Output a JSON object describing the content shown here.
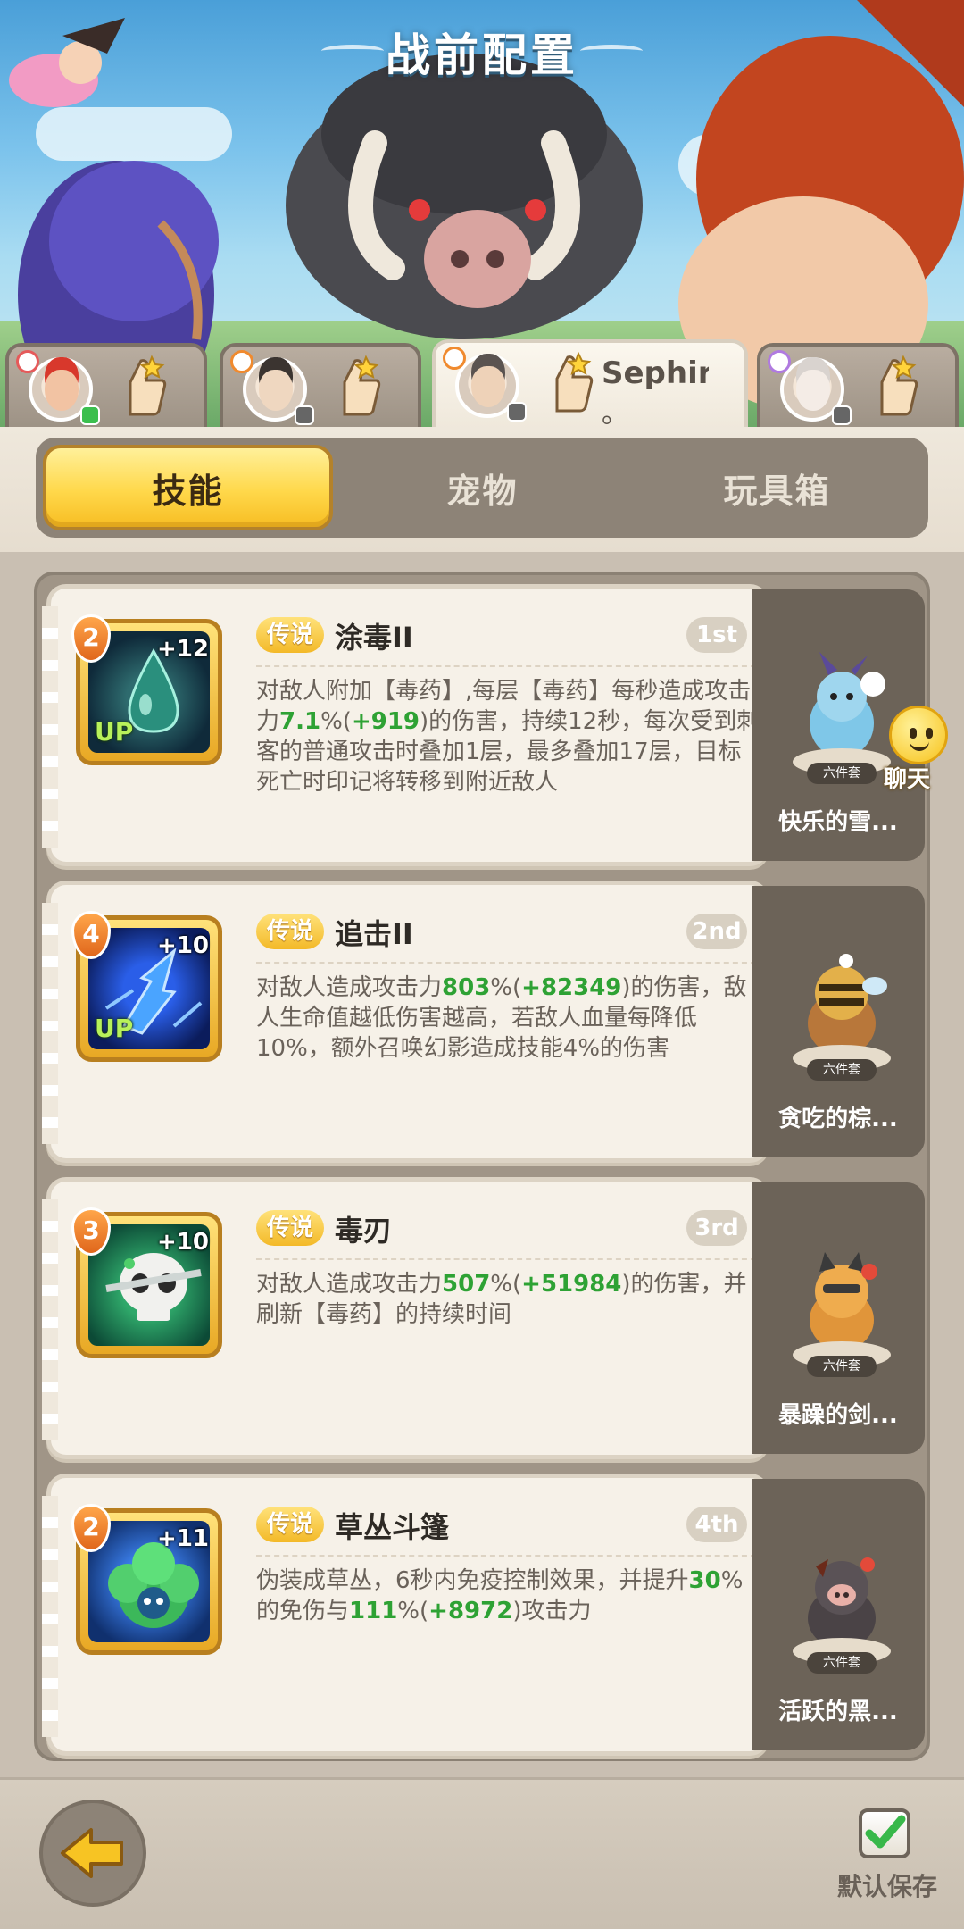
{
  "header": {
    "title": "战前配置"
  },
  "players": [
    {
      "name": "",
      "name_line2": "",
      "rank_color": "#e55a5a",
      "mic": "green"
    },
    {
      "name": "",
      "name_line2": "",
      "rank_color": "#f08a2e",
      "mic": "gray"
    },
    {
      "name": "Sephir..",
      "name_line2": "。",
      "rank_color": "#f08a2e",
      "mic": "gray",
      "active": true
    },
    {
      "name": "",
      "name_line2": "",
      "rank_color": "#b07ae0",
      "mic": "gray"
    }
  ],
  "category_tabs": [
    {
      "label": "技能",
      "active": true
    },
    {
      "label": "宠物",
      "active": false
    },
    {
      "label": "玩具箱",
      "active": false
    }
  ],
  "skills": [
    {
      "level": "2",
      "plus": "+12",
      "up": "UP",
      "rarity": "传说",
      "name": "涂毒II",
      "order": "1st",
      "desc_parts": [
        {
          "t": "对敌人附加【毒药】,每层【毒药】每秒造成攻击力"
        },
        {
          "t": "7.1",
          "g": true
        },
        {
          "t": "%("
        },
        {
          "t": "+919",
          "g": true
        },
        {
          "t": ")的伤害，持续12秒，每次受到刺客的普通攻击时叠加1层，最多叠加17层，目标死亡时印记将转移到附近敌人"
        }
      ],
      "icon": "poison-drop-icon",
      "pet": {
        "name": "快乐的雪...",
        "set": "六件套",
        "icon": "snow-rabbit-pet-icon"
      }
    },
    {
      "level": "4",
      "plus": "+10",
      "up": "UP",
      "rarity": "传说",
      "name": "追击II",
      "order": "2nd",
      "desc_parts": [
        {
          "t": "对敌人造成攻击力"
        },
        {
          "t": "803",
          "g": true
        },
        {
          "t": "%("
        },
        {
          "t": "+82349",
          "g": true
        },
        {
          "t": ")的伤害，敌人生命值越低伤害越高，若敌人血量每降低10%，额外召唤幻影造成技能4%的伤害"
        }
      ],
      "icon": "shadow-strike-icon",
      "pet": {
        "name": "贪吃的棕...",
        "set": "六件套",
        "icon": "brown-bear-bee-pet-icon"
      }
    },
    {
      "level": "3",
      "plus": "+10",
      "up": "",
      "rarity": "传说",
      "name": "毒刃",
      "order": "3rd",
      "desc_parts": [
        {
          "t": "对敌人造成攻击力"
        },
        {
          "t": "507",
          "g": true
        },
        {
          "t": "%("
        },
        {
          "t": "+51984",
          "g": true
        },
        {
          "t": ")的伤害，并刷新【毒药】的持续时间"
        }
      ],
      "icon": "skull-blade-icon",
      "pet": {
        "name": "暴躁的剑...",
        "set": "六件套",
        "icon": "sword-cat-pet-icon"
      }
    },
    {
      "level": "2",
      "plus": "+11",
      "up": "",
      "rarity": "传说",
      "name": "草丛斗篷",
      "order": "4th",
      "desc_parts": [
        {
          "t": "伪装成草丛，6秒内免疫控制效果，并提升"
        },
        {
          "t": "30",
          "g": true
        },
        {
          "t": "%的免伤与"
        },
        {
          "t": "111",
          "g": true
        },
        {
          "t": "%("
        },
        {
          "t": "+8972",
          "g": true
        },
        {
          "t": ")攻击力"
        }
      ],
      "icon": "bush-cloak-icon",
      "pet": {
        "name": "活跃的黑...",
        "set": "六件套",
        "icon": "black-boar-pet-icon"
      }
    }
  ],
  "chat": {
    "label": "聊天"
  },
  "footer": {
    "save_label": "默认保存"
  }
}
